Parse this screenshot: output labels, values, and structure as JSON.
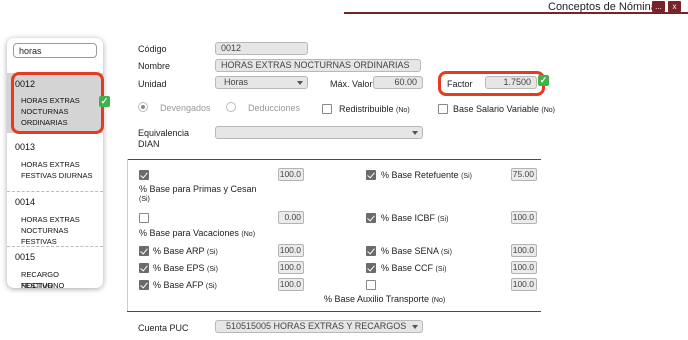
{
  "window": {
    "title": "Conceptos de Nómina",
    "minimize_label": "...",
    "close_label": "x"
  },
  "sidebar": {
    "search_value": "horas",
    "items": [
      {
        "code": "0012",
        "name_lines": [
          "HORAS EXTRAS",
          "NOCTURNAS",
          "ORDINARIAS"
        ],
        "selected": true
      },
      {
        "code": "0013",
        "name_lines": [
          "HORAS EXTRAS",
          "FESTIVAS DIURNAS"
        ]
      },
      {
        "code": "0014",
        "name_lines": [
          "HORAS EXTRAS",
          "NOCTURNAS FESTIVAS"
        ]
      },
      {
        "code": "0015",
        "name_lines": [
          "RECARGO NOCTURNO",
          "FESTIVO"
        ]
      }
    ]
  },
  "form": {
    "codigo_label": "Código",
    "codigo_value": "0012",
    "nombre_label": "Nombre",
    "nombre_value": "HORAS EXTRAS NOCTURNAS ORDINARIAS",
    "unidad_label": "Unidad",
    "unidad_value": "Horas",
    "max_valor_label": "Máx. Valor",
    "max_valor_value": "60.00",
    "factor_label": "Factor",
    "factor_value": "1.7500",
    "devengados_label": "Devengados",
    "deducciones_label": "Deducciones",
    "redistribuible_label": "Redistribuible",
    "redistribuible_note": "(No)",
    "base_salario_label": "Base Salario Variable",
    "base_salario_note": "(No)",
    "equivalencia_label_1": "Equivalencia",
    "equivalencia_label_2": "DIAN",
    "equivalencia_value": ""
  },
  "bases": {
    "primas_value": "100.0",
    "primas_label": "% Base para Primas y Cesan",
    "primas_note": "(Si)",
    "retefuente_label": "% Base Retefuente",
    "retefuente_note": "(Si)",
    "retefuente_value": "75.00",
    "vacaciones_value": "0.00",
    "vacaciones_label": "% Base para Vacaciones",
    "vacaciones_note": "(No)",
    "icbf_label": "% Base ICBF",
    "icbf_note": "(Si)",
    "icbf_value": "100.0",
    "arp_label": "% Base ARP",
    "arp_note": "(Si)",
    "arp_value": "100.0",
    "sena_label": "% Base SENA",
    "sena_note": "(Si)",
    "sena_value": "100.0",
    "eps_label": "% Base EPS",
    "eps_note": "(Si)",
    "eps_value": "100.0",
    "ccf_label": "% Base CCF",
    "ccf_note": "(Si)",
    "ccf_value": "100.0",
    "afp_label": "% Base AFP",
    "afp_note": "(Si)",
    "afp_value": "100.0",
    "aux_value": "100.0",
    "aux_label": "% Base Auxilio Transporte",
    "aux_note": "(No)"
  },
  "cuenta": {
    "label": "Cuenta PUC",
    "value": "510515005 HORAS EXTRAS Y RECARGOS"
  },
  "colors": {
    "accent": "#7a2326",
    "highlight": "#e63b22",
    "ok": "#3db34a"
  }
}
